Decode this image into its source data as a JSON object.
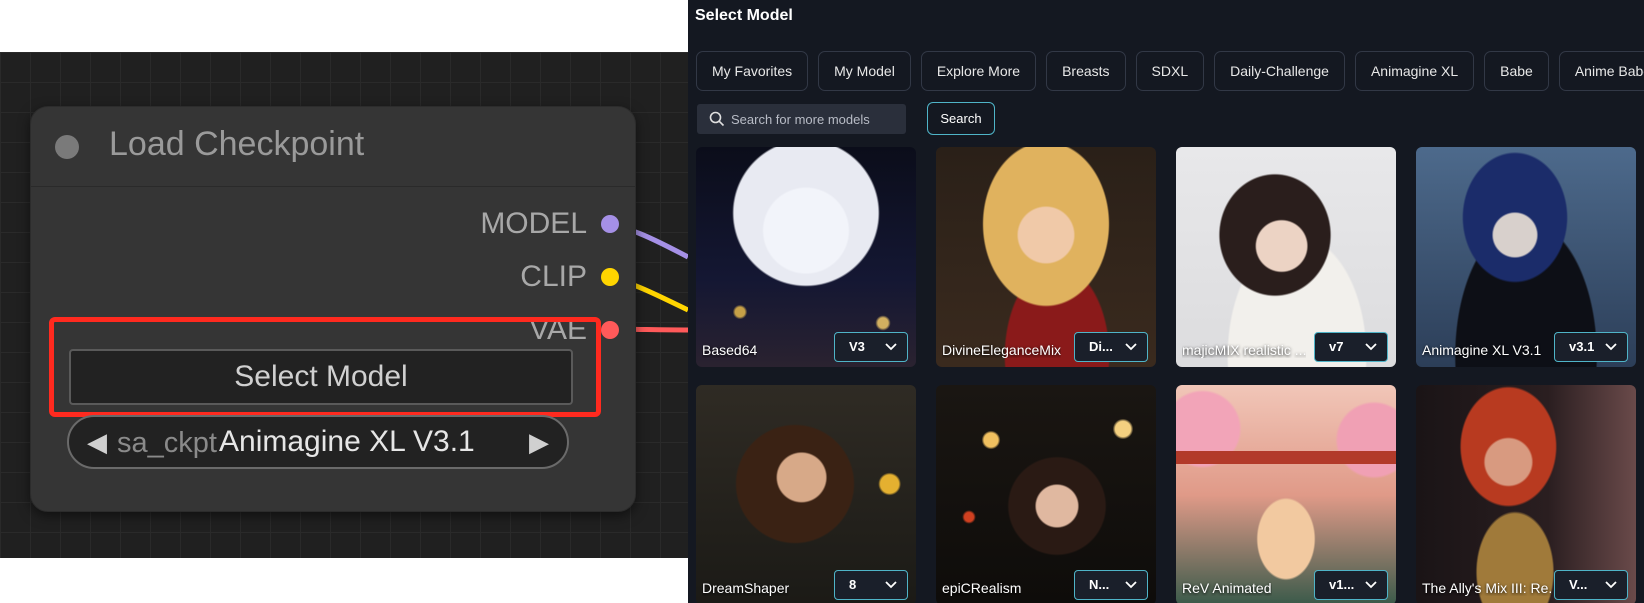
{
  "node": {
    "title": "Load Checkpoint",
    "outputs": [
      "MODEL",
      "CLIP",
      "VAE"
    ],
    "select_button_label": "Select Model",
    "combo_widget_name": "sa_ckpt",
    "combo_value": "Animagine XL V3.1",
    "colors": {
      "model": "#a590e6",
      "clip": "#ffd500",
      "vae": "#ff5a5a",
      "highlight": "#ff2a1f"
    }
  },
  "panel": {
    "title": "Select Model",
    "tabs": [
      "My Favorites",
      "My Model",
      "Explore More",
      "Breasts",
      "SDXL",
      "Daily-Challenge",
      "Animagine XL",
      "Babe",
      "Anime Babe"
    ],
    "search": {
      "placeholder": "Search for more models",
      "button_label": "Search"
    },
    "accent": "#4fb4c8",
    "models": [
      {
        "name": "Based64",
        "version": "V3"
      },
      {
        "name": "DivineEleganceMix",
        "version": "Di..."
      },
      {
        "name": "majicMIX realistic ...",
        "version": "v7"
      },
      {
        "name": "Animagine XL V3.1",
        "version": "v3.1"
      },
      {
        "name": "DreamShaper",
        "version": "8"
      },
      {
        "name": "epiCRealism",
        "version": "N..."
      },
      {
        "name": "ReV Animated",
        "version": "v1..."
      },
      {
        "name": "The Ally's Mix III: Re...",
        "version": "V..."
      }
    ]
  }
}
